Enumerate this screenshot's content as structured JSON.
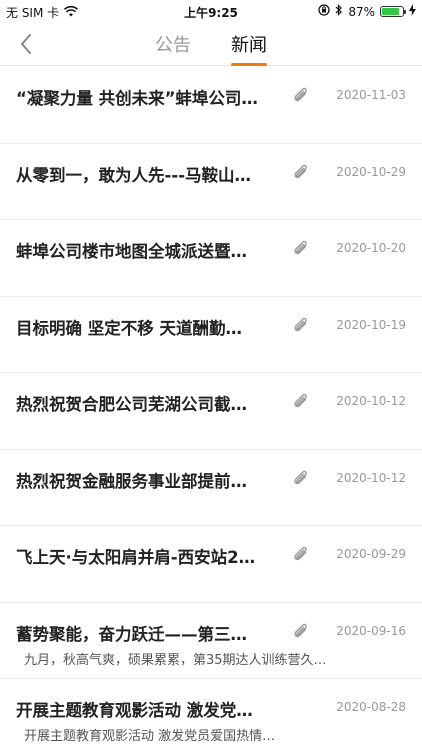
{
  "status_bar": {
    "carrier": "无 SIM 卡",
    "time": "上午9:25",
    "battery_percent": "87%",
    "battery_level": 0.87
  },
  "nav": {
    "tabs": [
      {
        "label": "公告",
        "active": false
      },
      {
        "label": "新闻",
        "active": true
      }
    ],
    "accent_color": "#f07a12"
  },
  "news": [
    {
      "title": "“凝聚力量 共创未来”蚌埠公司…",
      "date": "2020-11-03",
      "has_attachment": true,
      "summary": ""
    },
    {
      "title": "从零到一，敢为人先---马鞍山…",
      "date": "2020-10-29",
      "has_attachment": true,
      "summary": ""
    },
    {
      "title": "蚌埠公司楼市地图全城派送暨…",
      "date": "2020-10-20",
      "has_attachment": true,
      "summary": ""
    },
    {
      "title": "目标明确 坚定不移 天道酬勤…",
      "date": "2020-10-19",
      "has_attachment": true,
      "summary": ""
    },
    {
      "title": "热烈祝贺合肥公司芜湖公司截…",
      "date": "2020-10-12",
      "has_attachment": true,
      "summary": ""
    },
    {
      "title": "热烈祝贺金融服务事业部提前…",
      "date": "2020-10-12",
      "has_attachment": true,
      "summary": ""
    },
    {
      "title": "飞上天·与太阳肩并肩-西安站2…",
      "date": "2020-09-29",
      "has_attachment": true,
      "summary": ""
    },
    {
      "title": "蓄势聚能，奋力跃迁——第三…",
      "date": "2020-09-16",
      "has_attachment": true,
      "summary": "九月，秋高气爽，硕果累累，第35期达人训练营久…"
    },
    {
      "title": "开展主题教育观影活动 激发党…",
      "date": "2020-08-28",
      "has_attachment": false,
      "summary": "开展主题教育观影活动 激发党员爱国热情…"
    }
  ]
}
